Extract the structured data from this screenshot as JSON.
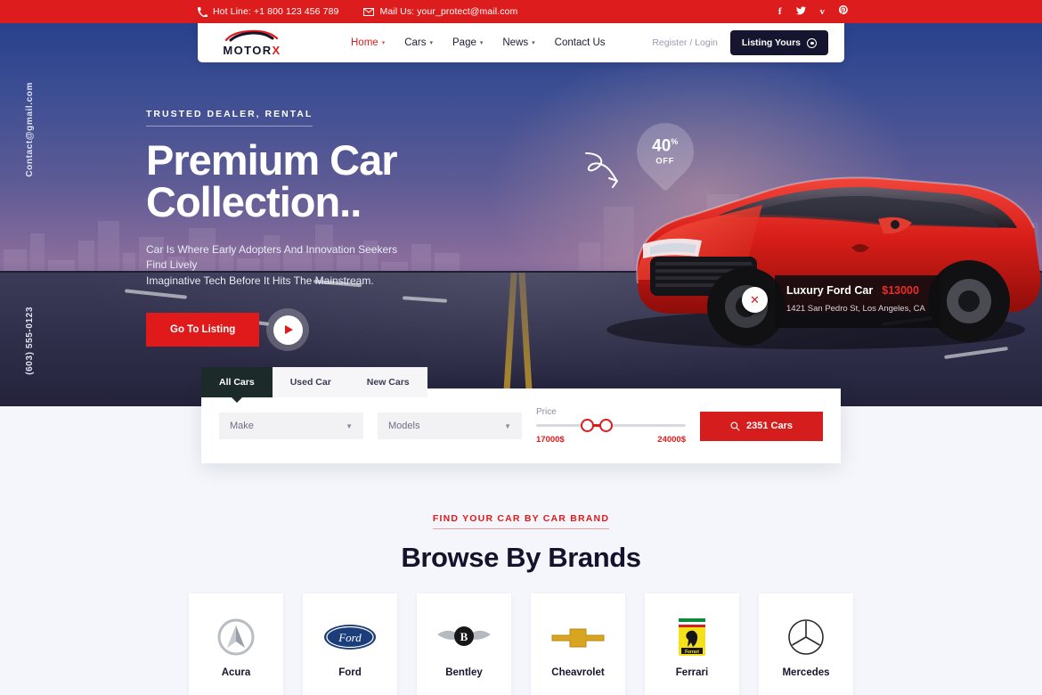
{
  "topbar": {
    "hotline": "Hot Line: +1 800 123 456 789",
    "mail": "Mail Us: your_protect@mail.com",
    "social": [
      {
        "name": "facebook-icon",
        "glyph": "f"
      },
      {
        "name": "twitter-icon",
        "glyph": "ᵛ"
      },
      {
        "name": "vimeo-icon",
        "glyph": "v"
      },
      {
        "name": "pinterest-icon",
        "glyph": "р"
      }
    ]
  },
  "nav": {
    "logo": {
      "prefix": "MOTOR",
      "accent": "X"
    },
    "items": [
      {
        "label": "Home",
        "caret": "▾",
        "active": true
      },
      {
        "label": "Cars",
        "caret": "▾",
        "active": false
      },
      {
        "label": "Page",
        "caret": "▾",
        "active": false
      },
      {
        "label": "News",
        "caret": "▾",
        "active": false
      },
      {
        "label": "Contact Us",
        "caret": "",
        "active": false
      }
    ],
    "register_login": "Register / Login",
    "listing_button": "Listing Yours"
  },
  "side": {
    "email": "Contact@gmail.com",
    "phone": "(603) 555-0123"
  },
  "hero": {
    "eyebrow": "TRUSTED DEALER, RENTAL",
    "title_line1": "Premium Car",
    "title_line2": "Collection..",
    "subtitle_line1": "Car Is Where Early Adopters And Innovation Seekers Find Lively",
    "subtitle_line2": "Imaginative Tech Before It Hits The Mainstream.",
    "cta": "Go To Listing",
    "discount_value": "40",
    "discount_symbol": "%",
    "discount_label": "OFF"
  },
  "car_card": {
    "name": "Luxury Ford Car",
    "price": "$13000",
    "address": "1421 San Pedro St, Los Angeles, CA",
    "close": "✕"
  },
  "search": {
    "tabs": [
      {
        "label": "All Cars",
        "active": true
      },
      {
        "label": "Used Car",
        "active": false
      },
      {
        "label": "New Cars",
        "active": false
      }
    ],
    "make_value": "Make",
    "models_value": "Models",
    "price_label": "Price",
    "price_min": "17000$",
    "price_max": "24000$",
    "search_button": "2351 Cars"
  },
  "brands": {
    "eyebrow": "FIND YOUR CAR BY CAR BRAND",
    "title": "Browse By Brands",
    "items": [
      {
        "name": "Acura",
        "logo": "acura-logo"
      },
      {
        "name": "Ford",
        "logo": "ford-logo"
      },
      {
        "name": "Bentley",
        "logo": "bentley-logo"
      },
      {
        "name": "Cheavrolet",
        "logo": "chevrolet-logo"
      },
      {
        "name": "Ferrari",
        "logo": "ferrari-logo"
      },
      {
        "name": "Mercedes",
        "logo": "mercedes-logo"
      }
    ]
  },
  "colors": {
    "brand_red": "#dd1d1d",
    "dark_navy": "#151530",
    "page_bg": "#f4f6fb"
  }
}
